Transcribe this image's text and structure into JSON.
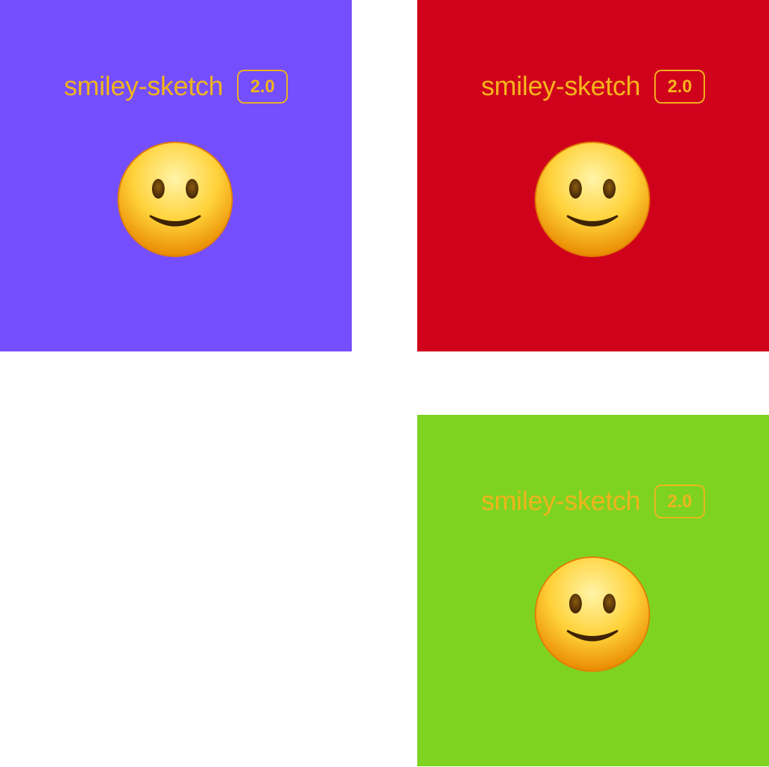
{
  "tiles": [
    {
      "id": "purple",
      "background": "#754ffe",
      "brand_name": "smiley-sketch",
      "version": "2.0",
      "text_color": "#f0b31d",
      "icon": "smiley-face-icon"
    },
    {
      "id": "red",
      "background": "#d0021b",
      "brand_name": "smiley-sketch",
      "version": "2.0",
      "text_color": "#f7b51c",
      "icon": "smiley-face-icon"
    },
    {
      "id": "green",
      "background": "#7ed321",
      "brand_name": "smiley-sketch",
      "version": "2.0",
      "text_color": "#f0b41d",
      "icon": "smiley-face-icon"
    }
  ],
  "colors": {
    "page_background": "#ffffff",
    "face_light": "#fff4a8",
    "face_mid": "#ffd23a",
    "face_dark": "#e98a00",
    "feature_dark": "#3f2304"
  }
}
